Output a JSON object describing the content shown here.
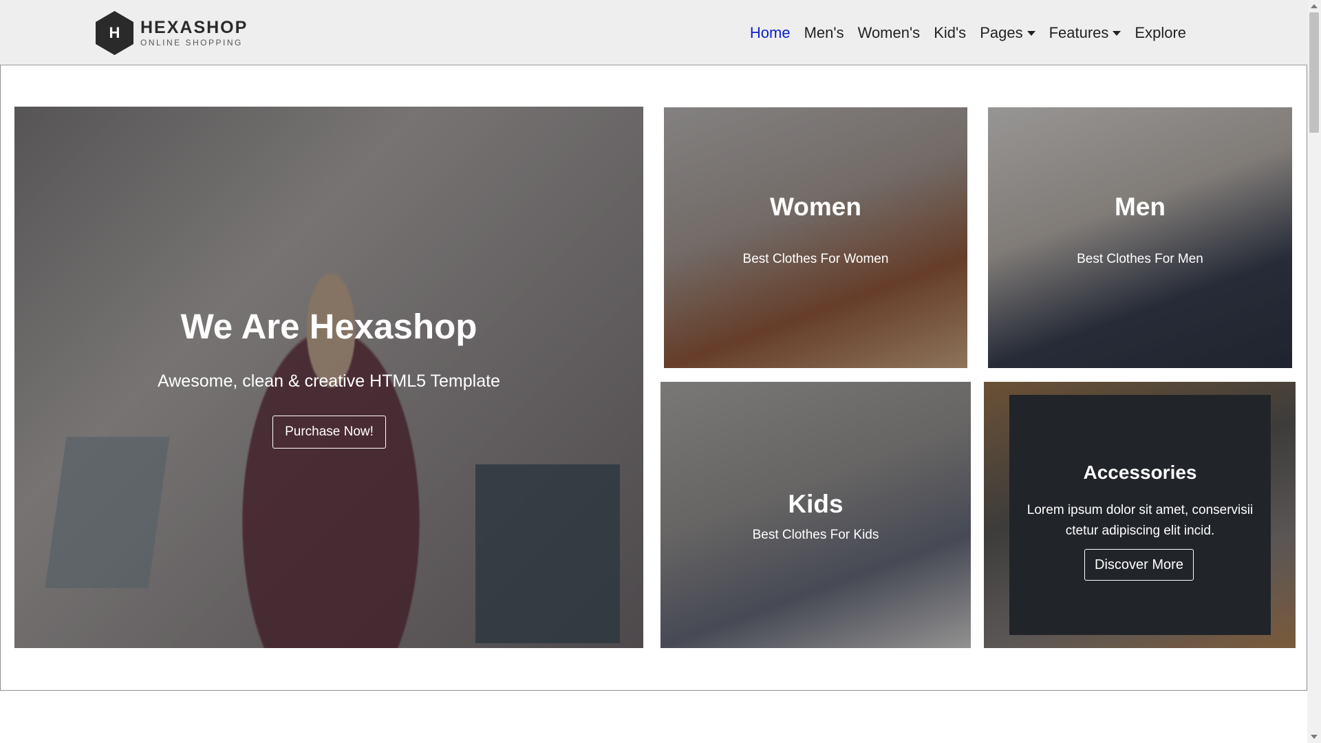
{
  "brand": {
    "name": "HEXASHOP",
    "tagline": "ONLINE SHOPPING",
    "logo_letter": "H"
  },
  "nav": {
    "items": [
      {
        "label": "Home",
        "active": true,
        "dropdown": false
      },
      {
        "label": "Men's",
        "active": false,
        "dropdown": false
      },
      {
        "label": "Women's",
        "active": false,
        "dropdown": false
      },
      {
        "label": "Kid's",
        "active": false,
        "dropdown": false
      },
      {
        "label": "Pages",
        "active": false,
        "dropdown": true
      },
      {
        "label": "Features",
        "active": false,
        "dropdown": true
      },
      {
        "label": "Explore",
        "active": false,
        "dropdown": false
      }
    ]
  },
  "hero": {
    "title": "We Are Hexashop",
    "subtitle": "Awesome, clean & creative HTML5 Template",
    "button_label": "Purchase Now!"
  },
  "categories": {
    "women": {
      "title": "Women",
      "subtitle": "Best Clothes For Women"
    },
    "men": {
      "title": "Men",
      "subtitle": "Best Clothes For Men"
    },
    "kids": {
      "title": "Kids",
      "subtitle": "Best Clothes For Kids"
    },
    "accessories": {
      "title": "Accessories",
      "text": "Lorem ipsum dolor sit amet, conservisii ctetur adipiscing elit incid.",
      "button_label": "Discover More"
    }
  },
  "colors": {
    "nav_active": "#0d1fc9",
    "navbar_bg": "#eeeeee",
    "card_dark": "#212429"
  }
}
